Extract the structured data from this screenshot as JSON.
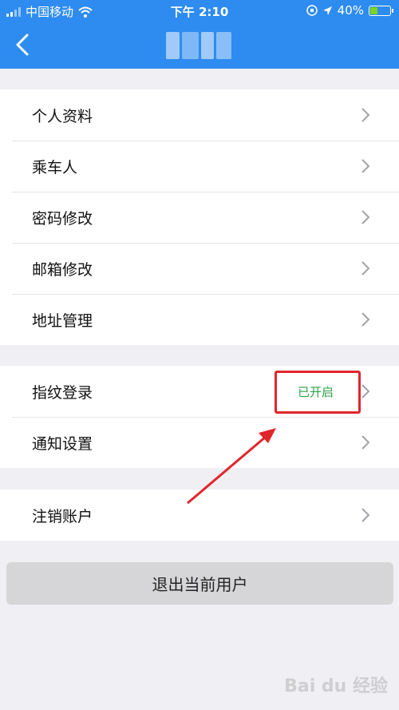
{
  "status_bar": {
    "carrier": "中国移动",
    "time": "下午 2:10",
    "battery_pct": "40%",
    "battery_level": 0.4
  },
  "nav": {
    "back_icon": "chevron-left-icon"
  },
  "groups": [
    {
      "items": [
        {
          "label": "个人资料"
        },
        {
          "label": "乘车人"
        },
        {
          "label": "密码修改"
        },
        {
          "label": "邮箱修改"
        },
        {
          "label": "地址管理"
        }
      ]
    },
    {
      "items": [
        {
          "label": "指纹登录",
          "status": "已开启"
        },
        {
          "label": "通知设置"
        }
      ]
    },
    {
      "items": [
        {
          "label": "注销账户"
        }
      ]
    }
  ],
  "logout_label": "退出当前用户",
  "watermark": "Bai du 经验",
  "colors": {
    "header": "#2e8cf0",
    "status_on": "#2ba245",
    "highlight": "#e0262b"
  }
}
